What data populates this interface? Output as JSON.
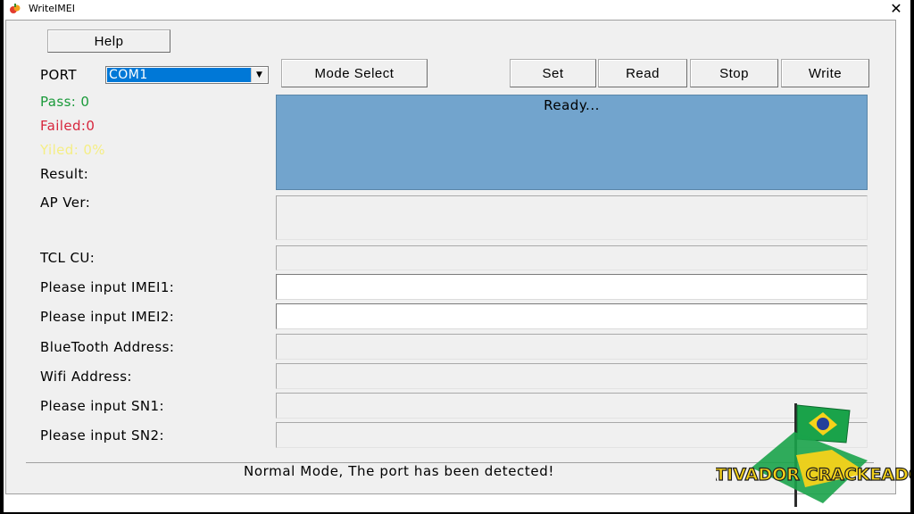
{
  "window": {
    "title": "WriteIMEI",
    "close_glyph": "✕",
    "icon": "app-icon"
  },
  "toolbar": {
    "help_label": "Help",
    "port_label": "PORT",
    "port_value": "COM1",
    "mode_select_label": "Mode Select",
    "set_label": "Set",
    "read_label": "Read",
    "stop_label": "Stop",
    "write_label": "Write"
  },
  "stats": {
    "pass_label": "Pass:  0",
    "failed_label": "Failed:0",
    "yield_label": "Yiled: 0%",
    "result_label": "Result:"
  },
  "colors": {
    "pass": "#1a9a3a",
    "failed": "#d7263d",
    "yield": "#f5ee84",
    "status_panel": "#72a4cd"
  },
  "status": {
    "text": "Ready..."
  },
  "form": {
    "ap_ver_label": "AP Ver:",
    "tcl_cu_label": "TCL CU:",
    "imei1_label": "Please input IMEI1:",
    "imei2_label": "Please input IMEI2:",
    "bt_label": "BlueTooth Address:",
    "wifi_label": "Wifi Address:",
    "sn1_label": "Please input SN1:",
    "sn2_label": "Please input SN2:",
    "imei1_value": "",
    "imei2_value": ""
  },
  "footer": {
    "message": "Normal Mode, The port has been detected!"
  },
  "watermark": {
    "text": "ATIVADOR CRACKEADO"
  }
}
